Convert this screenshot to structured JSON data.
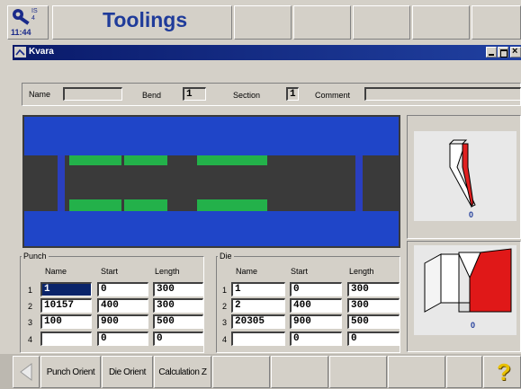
{
  "app": {
    "clock": "11:44",
    "screen_title": "Toolings"
  },
  "window": {
    "title": "Kvara"
  },
  "params": {
    "name_label": "Name",
    "name_value": "",
    "bend_label": "Bend",
    "bend_value": "1",
    "section_label": "Section",
    "section_value": "1",
    "comment_label": "Comment",
    "comment_value": ""
  },
  "preview": {
    "punch_count": "0",
    "die_count": "0"
  },
  "punch": {
    "group_label": "Punch",
    "headers": [
      "Name",
      "Start",
      "Length"
    ],
    "rows": [
      {
        "num": "1",
        "name": "1",
        "start": "0",
        "length": "300"
      },
      {
        "num": "2",
        "name": "10157",
        "start": "400",
        "length": "300"
      },
      {
        "num": "3",
        "name": "100",
        "start": "900",
        "length": "500"
      },
      {
        "num": "4",
        "name": "",
        "start": "0",
        "length": "0"
      }
    ]
  },
  "die": {
    "group_label": "Die",
    "headers": [
      "Name",
      "Start",
      "Length"
    ],
    "rows": [
      {
        "num": "1",
        "name": "1",
        "start": "0",
        "length": "300"
      },
      {
        "num": "2",
        "name": "2",
        "start": "400",
        "length": "300"
      },
      {
        "num": "3",
        "name": "20305",
        "start": "900",
        "length": "500"
      },
      {
        "num": "4",
        "name": "",
        "start": "0",
        "length": "0"
      }
    ]
  },
  "toolbar": {
    "punch_orient_label": "Punch Orient",
    "die_orient_label": "Die Orient",
    "calculation_label": "Calculation Z"
  }
}
